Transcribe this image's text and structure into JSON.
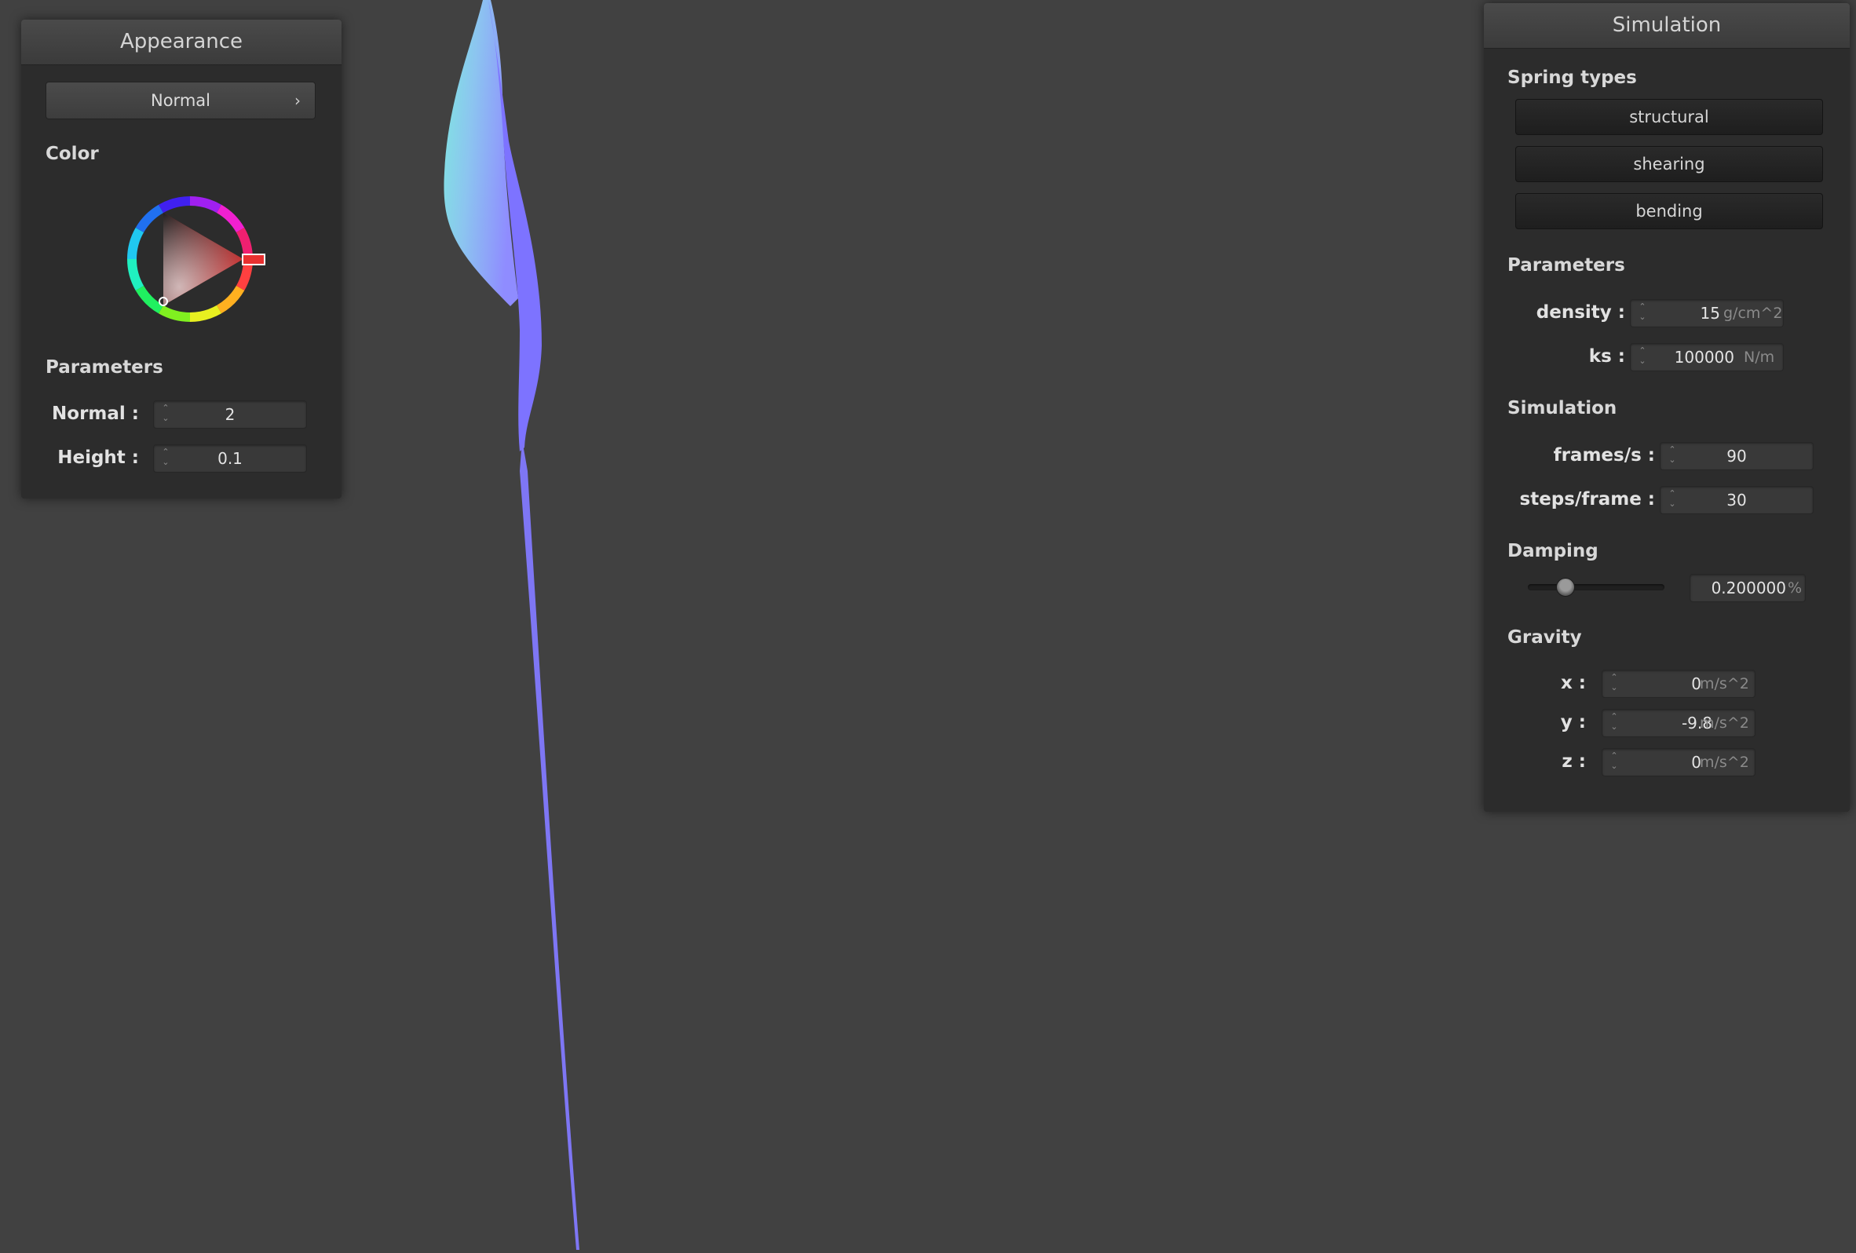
{
  "appearance": {
    "title": "Appearance",
    "shader_select": "Normal",
    "color_label": "Color",
    "parameters_label": "Parameters",
    "normal_label": "Normal :",
    "normal_value": "2",
    "height_label": "Height :",
    "height_value": "0.1",
    "selected_color": "#e02020"
  },
  "simulation": {
    "title": "Simulation",
    "spring_types_label": "Spring types",
    "spring_buttons": [
      "structural",
      "shearing",
      "bending"
    ],
    "parameters_label": "Parameters",
    "density_label": "density :",
    "density_value": "15",
    "density_unit": "g/cm^2",
    "ks_label": "ks :",
    "ks_value": "100000",
    "ks_unit": "N/m",
    "sim_label": "Simulation",
    "fps_label": "frames/s :",
    "fps_value": "90",
    "steps_label": "steps/frame :",
    "steps_value": "30",
    "damping_label": "Damping",
    "damping_value": "0.200000",
    "damping_unit": "%",
    "damping_slider_fraction": 0.2,
    "gravity_label": "Gravity",
    "gx_label": "x :",
    "gx_value": "0",
    "gy_label": "y :",
    "gy_value": "-9.8",
    "gz_label": "z :",
    "gz_value": "0",
    "gravity_unit": "m/s^2"
  },
  "icons": {
    "chevron": "chevron-right-icon",
    "spin": "spin-arrows-icon"
  },
  "arrows_glyph": "⌃\n⌄",
  "chevron_glyph": "›"
}
